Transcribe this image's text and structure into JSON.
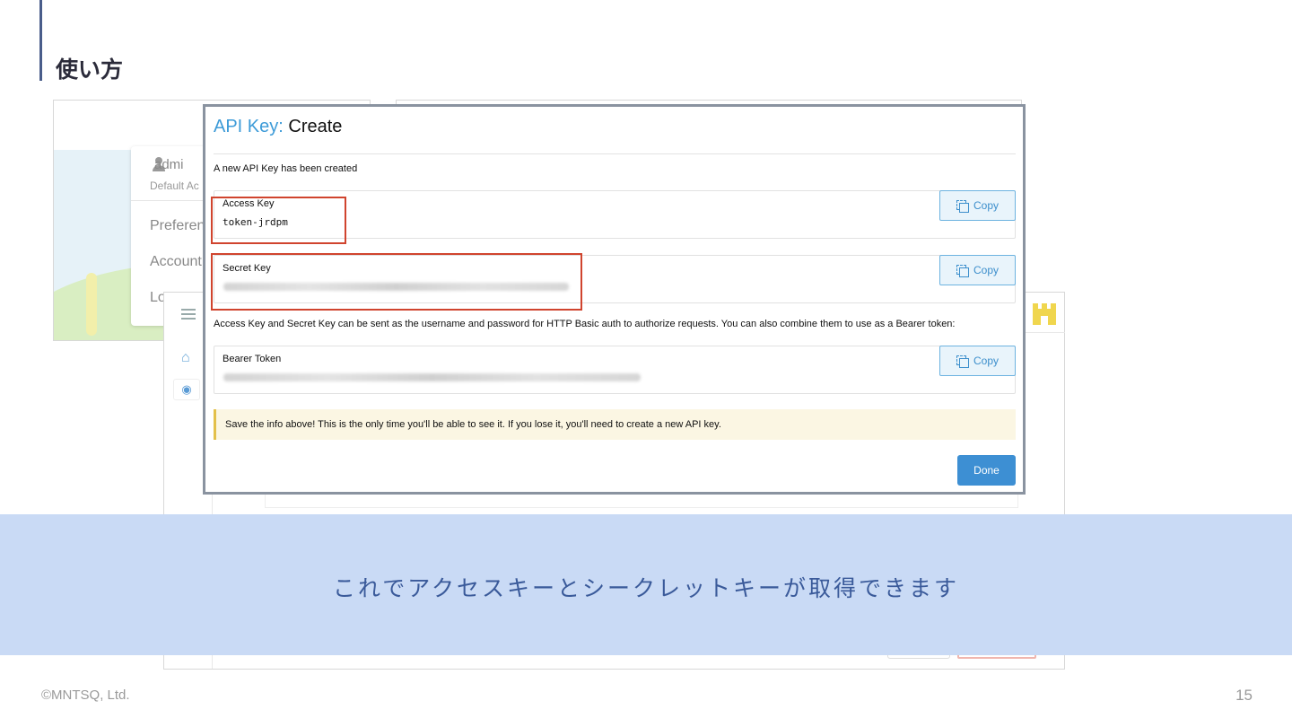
{
  "slide": {
    "title": "使い方",
    "caption": "これでアクセスキーとシークレットキーが取得できます",
    "footer": "©MNTSQ, Ltd.",
    "page_number": "15"
  },
  "background_ui": {
    "user_menu": {
      "user_name": "admi",
      "subtitle": "Default Ac",
      "items": [
        "Preferen",
        "Account",
        "Lo"
      ]
    }
  },
  "modal": {
    "title_prefix": "API Key:",
    "title_main": "Create",
    "created_message": "A new API Key has been created",
    "access_key": {
      "label": "Access Key",
      "value": "token-jrdpm"
    },
    "secret_key": {
      "label": "Secret Key"
    },
    "auth_note": "Access Key and Secret Key can be sent as the username and password for HTTP Basic auth to authorize requests. You can also combine them to use as a Bearer token:",
    "bearer_token": {
      "label": "Bearer Token"
    },
    "copy_label": "Copy",
    "warning": "Save the info above! This is the only time you'll be able to see it. If you lose it, you'll need to create a new API key.",
    "done_label": "Done"
  },
  "colors": {
    "accent": "#3d9bd8",
    "highlight_border": "#d0442e",
    "caption_band": "#c9daf5",
    "caption_text": "#3a5a9a",
    "done_button": "#3d8fd3"
  }
}
